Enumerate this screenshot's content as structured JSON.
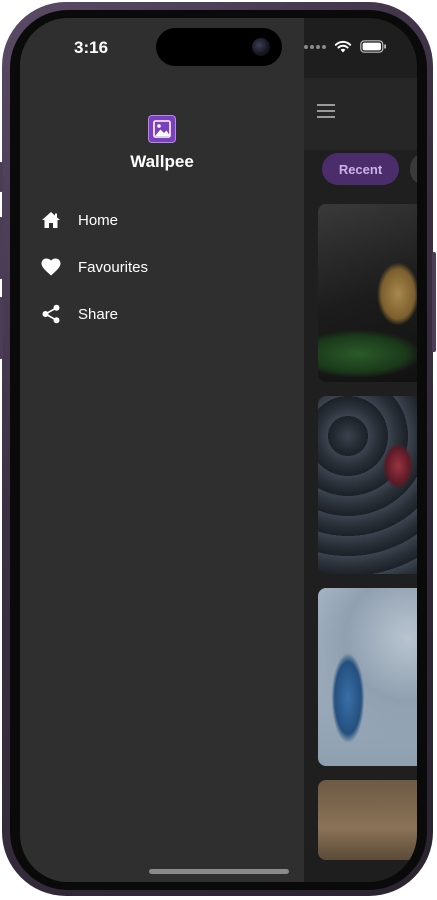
{
  "status_bar": {
    "time": "3:16",
    "icons": [
      "signal-dots-icon",
      "wifi-icon",
      "battery-icon"
    ]
  },
  "drawer": {
    "brand": {
      "logo_icon": "image-gallery-icon",
      "name": "Wallpee"
    },
    "items": [
      {
        "label": "Home",
        "icon": "home-icon"
      },
      {
        "label": "Favourites",
        "icon": "heart-icon"
      },
      {
        "label": "Share",
        "icon": "share-icon"
      }
    ]
  },
  "main": {
    "menu_icon": "hamburger-icon",
    "chips": [
      {
        "label": "Recent",
        "selected": true
      }
    ],
    "wallpapers": [
      "ganesha-idol-leaf",
      "butterfly-dark-leaves",
      "peacock-blue-flowers",
      "sepia-texture"
    ]
  },
  "colors": {
    "accent": "#7b3fbf",
    "chip_selected_bg": "#4b2d6b",
    "drawer_bg": "#2f2f2f",
    "text": "#ffffff"
  }
}
